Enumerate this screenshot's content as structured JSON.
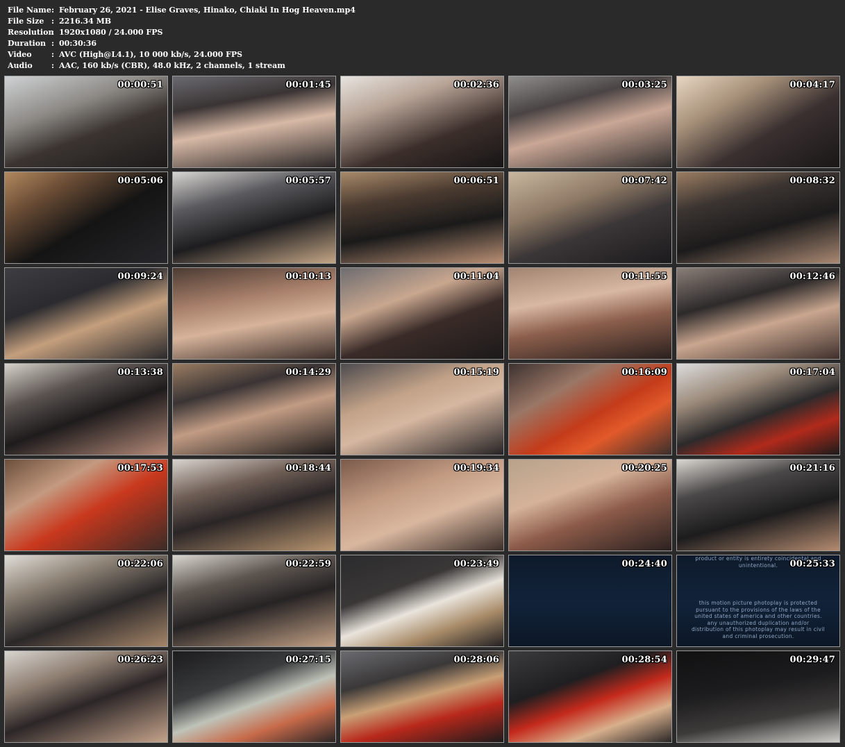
{
  "info": [
    {
      "key": "File Name",
      "sep": ":",
      "value": "February 26, 2021 - Elise Graves, Hinako, Chiaki In Hog Heaven.mp4"
    },
    {
      "key": "File Size",
      "sep": ":",
      "value": "2216.34 MB"
    },
    {
      "key": "Resolution",
      "sep": ":",
      "value": "1920x1080 / 24.000 FPS"
    },
    {
      "key": "Duration",
      "sep": ":",
      "value": "00:30:36"
    },
    {
      "key": "Video",
      "sep": ":",
      "value": "AVC (High@L4.1), 10 000 kb/s, 24.000 FPS"
    },
    {
      "key": "Audio",
      "sep": ":",
      "value": "AAC, 160 kb/s (CBR), 48.0 kHz, 2 channels, 1 stream"
    }
  ],
  "thumbnails": [
    {
      "time": "00:00:51"
    },
    {
      "time": "00:01:45"
    },
    {
      "time": "00:02:36"
    },
    {
      "time": "00:03:25"
    },
    {
      "time": "00:04:17"
    },
    {
      "time": "00:05:06"
    },
    {
      "time": "00:05:57"
    },
    {
      "time": "00:06:51"
    },
    {
      "time": "00:07:42"
    },
    {
      "time": "00:08:32"
    },
    {
      "time": "00:09:24"
    },
    {
      "time": "00:10:13"
    },
    {
      "time": "00:11:04"
    },
    {
      "time": "00:11:55"
    },
    {
      "time": "00:12:46"
    },
    {
      "time": "00:13:38"
    },
    {
      "time": "00:14:29"
    },
    {
      "time": "00:15:19"
    },
    {
      "time": "00:16:09"
    },
    {
      "time": "00:17:04"
    },
    {
      "time": "00:17:53"
    },
    {
      "time": "00:18:44"
    },
    {
      "time": "00:19:34"
    },
    {
      "time": "00:20:25"
    },
    {
      "time": "00:21:16"
    },
    {
      "time": "00:22:06"
    },
    {
      "time": "00:22:59"
    },
    {
      "time": "00:23:49"
    },
    {
      "time": "00:24:40"
    },
    {
      "time": "00:25:33"
    },
    {
      "time": "00:26:23"
    },
    {
      "time": "00:27:15"
    },
    {
      "time": "00:28:06"
    },
    {
      "time": "00:28:54"
    },
    {
      "time": "00:29:47"
    }
  ],
  "overlay_25_33": {
    "top": "product or entity is entirety coincidental and\nunintentional.",
    "middle": "this motion picture photoplay is protected\npursuant to the provisions of the laws of the\nunited states of america and other countries.\nany unauthorized duplication and/or\ndistribution of this photoplay may result in civil\nand criminal prosecution."
  },
  "colors": {
    "background": "#2a2a2a",
    "text": "#ffffff",
    "thumb_border": "#9a9a9a"
  }
}
